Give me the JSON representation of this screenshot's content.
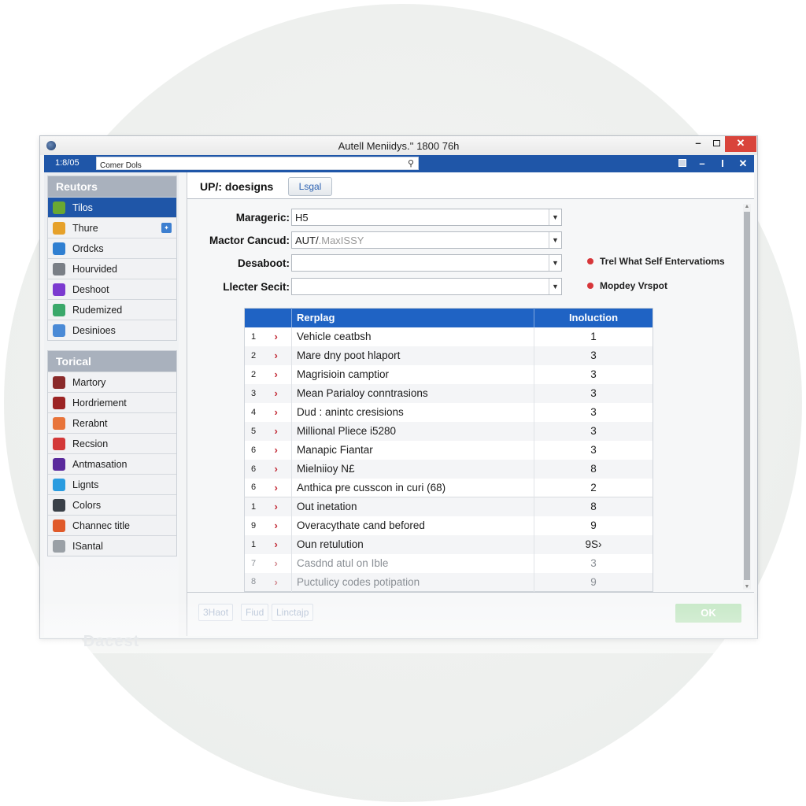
{
  "window": {
    "title": "Autell Meniidys.'' 1800 76h",
    "controls": {
      "minimize": "–",
      "close": "✕"
    }
  },
  "toolbar": {
    "label": "1:8/05",
    "search_value": "Comer Dols",
    "search_icon": "search-icon",
    "icons": [
      "image-icon",
      "minimize-icon",
      "info-icon",
      "close-icon"
    ],
    "icon_glyphs": [
      "",
      "–",
      "I",
      "✕"
    ]
  },
  "sidebar": {
    "groups": [
      {
        "heading": "Reutors",
        "items": [
          {
            "label": "Tilos",
            "icon": "shield-icon",
            "color": "#6aa832",
            "active": true
          },
          {
            "label": "Thure",
            "icon": "photo-icon",
            "color": "#e6a12a",
            "badge": "✦"
          },
          {
            "label": "Ordcks",
            "icon": "globe-icon",
            "color": "#2f7fd1"
          },
          {
            "label": "Hourvided",
            "icon": "tools-icon",
            "color": "#7a7f86"
          },
          {
            "label": "Deshoot",
            "icon": "figure-icon",
            "color": "#7c3ad0"
          },
          {
            "label": "Rudemized",
            "icon": "blocks-icon",
            "color": "#3aa86a"
          },
          {
            "label": "Desinioes",
            "icon": "monitor-icon",
            "color": "#4a8ad6"
          }
        ]
      },
      {
        "heading": "Torical",
        "items": [
          {
            "label": "Martory",
            "icon": "book-icon",
            "color": "#8a2a2a"
          },
          {
            "label": "Hordriement",
            "icon": "chip-icon",
            "color": "#9c2424"
          },
          {
            "label": "Rerabnt",
            "icon": "flame-icon",
            "color": "#e8743a"
          },
          {
            "label": "Recsion",
            "icon": "tag-icon",
            "color": "#d33838"
          },
          {
            "label": "Antmasation",
            "icon": "animation-icon",
            "color": "#5a2a9c"
          },
          {
            "label": "Lignts",
            "icon": "lights-icon",
            "color": "#2a9ce0"
          },
          {
            "label": "Colors",
            "icon": "bucket-icon",
            "color": "#3a4048"
          },
          {
            "label": "Channec title",
            "icon": "channel-icon",
            "color": "#e05a2a"
          },
          {
            "label": "ISantal",
            "icon": "display-icon",
            "color": "#9aa0a6"
          }
        ]
      }
    ],
    "footer": "Dacest"
  },
  "main": {
    "title": "UP/: doesigns",
    "header_button": "Lsgal",
    "fields": [
      {
        "label": "Marageric:",
        "value": "H5",
        "faded_value": ""
      },
      {
        "label": "Mactor Cancud:",
        "value": "AUT/",
        "faded_value": ".MaxISSY"
      },
      {
        "label": "Desaboot:",
        "value": "",
        "faded_value": ""
      },
      {
        "label": "Llecter Secit:",
        "value": "",
        "faded_value": ""
      }
    ],
    "notes": [
      {
        "text": "Trel What Self Entervatioms",
        "color": "#d7363a"
      },
      {
        "text": "Mopdey Vrspot",
        "color": "#d7363a"
      }
    ],
    "table": {
      "columns": [
        "",
        "Rerplag",
        "Inoluction"
      ],
      "rows": [
        {
          "num": "1",
          "name": "Vehicle ceatbsh",
          "value": "1"
        },
        {
          "num": "2",
          "name": "Mare dny poot hlaport",
          "value": "3"
        },
        {
          "num": "2",
          "name": "Magrisioin camptior",
          "value": "3"
        },
        {
          "num": "3",
          "name": "Mean Parialoy conntrasions",
          "value": "3"
        },
        {
          "num": "4",
          "name": "Dud : anintc cresisions",
          "value": "3"
        },
        {
          "num": "5",
          "name": "Millional Pliece i5280",
          "value": "3"
        },
        {
          "num": "6",
          "name": "Manapic Fiantar",
          "value": "3"
        },
        {
          "num": "6",
          "name": "Mielniioy N£",
          "value": "8"
        },
        {
          "num": "6",
          "name": "Anthica pre cusscon in curi (68)",
          "value": "2"
        },
        {
          "num": "1",
          "name": "Out inetation",
          "value": "8"
        },
        {
          "num": "9",
          "name": "Overacythate cand befored",
          "value": "9"
        },
        {
          "num": "1",
          "name": "Oun retulution",
          "value": "9S›"
        },
        {
          "num": "7",
          "name": "Casdnd atul on Ible",
          "value": "3",
          "faded": true
        },
        {
          "num": "8",
          "name": "Puctulicy codes potipation",
          "value": "9",
          "faded": true
        }
      ]
    },
    "footer_buttons": [
      "3Haot",
      "Fiud",
      "Linctajp"
    ],
    "ok_label": "OK"
  }
}
